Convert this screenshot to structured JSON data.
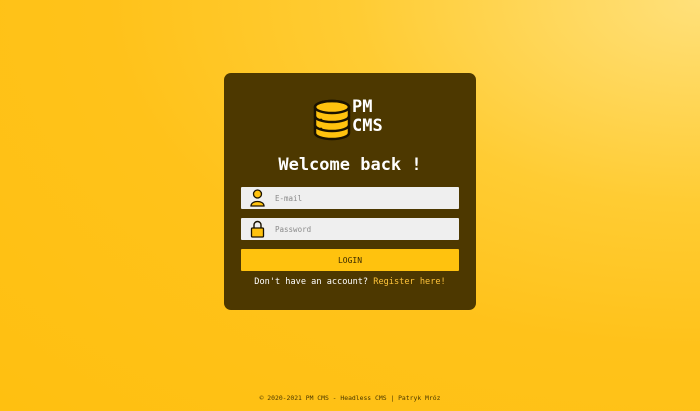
{
  "brand": {
    "line1": "PM",
    "line2": "CMS"
  },
  "heading": "Welcome back !",
  "email": {
    "placeholder": "E-mail",
    "value": ""
  },
  "password": {
    "placeholder": "Password",
    "value": ""
  },
  "login_label": "LOGIN",
  "register": {
    "prompt": "Don't have an account?",
    "link_label": "Register here!"
  },
  "footer": "© 2020-2021 PM CMS - Headless CMS | Patryk Mróz",
  "icons": {
    "logo": "database-icon",
    "email": "user-icon",
    "password": "lock-icon"
  },
  "colors": {
    "card": "#4d3800",
    "accent": "#ffc20e",
    "link": "#ffc43a"
  }
}
